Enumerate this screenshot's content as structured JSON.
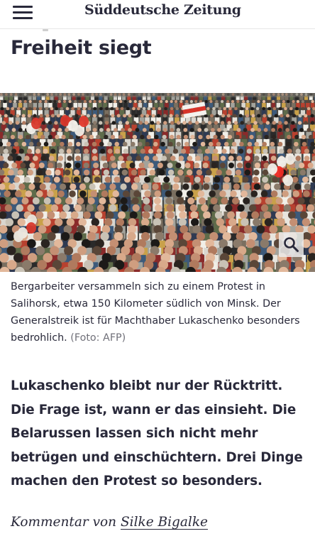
{
  "header": {
    "menu_icon": "hamburger-menu-icon",
    "logo_text": "Süddeutsche Zeitung"
  },
  "article": {
    "headline": "Freiheit siegt",
    "image": {
      "description_icon": "zoom-icon"
    },
    "caption": {
      "text": "Bergarbeiter versammeln sich zu einem Protest in Salihorsk, etwa 150 Kilometer südlich von Minsk. Der Generalstreik ist für Machthaber Lukaschenko besonders bedrohlich.",
      "credit": "(Foto: AFP)"
    },
    "teaser": "Lukaschenko bleibt nur der Rücktritt. Die Frage ist, wann er das einsieht. Die Belarussen lassen sich nicht mehr betrügen und einschüchtern. Drei Dinge machen den Protest so besonders.",
    "byline": {
      "prefix": "Kommentar von",
      "author": "Silke Bigalke"
    }
  },
  "colors": {
    "text": "#29293a",
    "muted": "#71717a",
    "divider": "#e6e6e6"
  }
}
